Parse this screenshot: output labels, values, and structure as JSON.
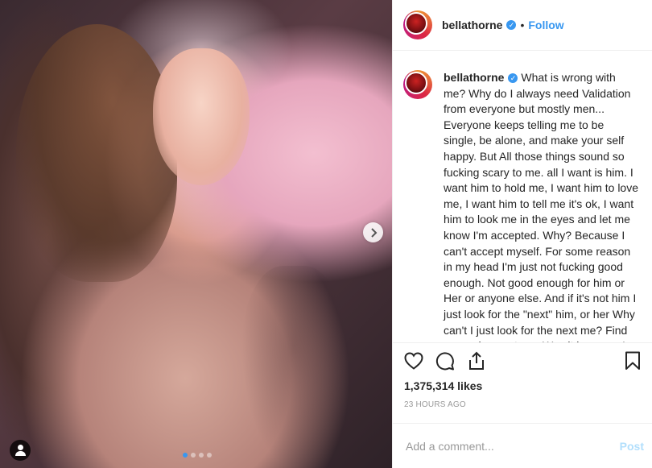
{
  "media": {
    "slide_count": 4,
    "active_slide": 1
  },
  "post": {
    "username": "bellathorne",
    "verified": true,
    "follow_label": "Follow",
    "separator": "•",
    "caption": "What is wrong with me? Why do I always need Validation from everyone but mostly men... Everyone keeps telling me to be single, be alone, and make your self happy. But All those things sound so fucking scary to me. all I want is him. I want him to hold me, I want him to love me, I want him to tell me it's ok, I want him to look me in the eyes and let me know I'm accepted. Why? Because I can't accept myself. For some reason in my head I'm just not fucking good enough. Not good enough for him or Her or anyone else. And if it's not him I just look for the \"next\" him, or her Why can't I just look for the next me? Find me and accept me. Was it because I was molested my whole life. Exposed to sex at such a",
    "likes": "1,375,314 likes",
    "timestamp": "23 HOURS AGO"
  },
  "comment_box": {
    "placeholder": "Add a comment...",
    "post_label": "Post"
  },
  "icons": {
    "next": "chevron-right-icon",
    "like": "heart-icon",
    "comment": "speech-bubble-icon",
    "share": "share-icon",
    "save": "bookmark-icon",
    "tags": "user-tag-icon",
    "verified": "verified-badge-icon"
  },
  "colors": {
    "link": "#3897f0",
    "muted": "#999999",
    "post_disabled": "#b2dffc",
    "text": "#262626"
  }
}
